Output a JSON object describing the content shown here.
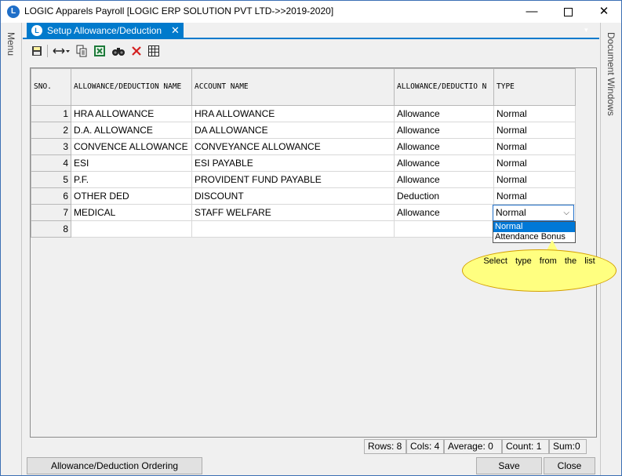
{
  "window": {
    "title": "LOGIC Apparels Payroll  [LOGIC ERP SOLUTION PVT LTD->>2019-2020]",
    "logo_letter": "L",
    "controls": {
      "minimize": "—",
      "close": "✕"
    }
  },
  "side": {
    "left_label": "Menu",
    "right_label": "Document Windows"
  },
  "tab": {
    "label": "Setup Allowance/Deduction",
    "close": "✕",
    "logo_letter": "L",
    "dropdown": "▾"
  },
  "toolbar": {
    "icons": [
      "save-icon",
      "column-resize-icon",
      "copy-icon",
      "excel-icon",
      "find-icon",
      "delete-icon",
      "grid-icon"
    ]
  },
  "grid": {
    "headers": {
      "sno": "SNO.",
      "name": "ALLOWANCE/DEDUCTION NAME",
      "account": "ACCOUNT NAME",
      "allowance_deduction": "ALLOWANCE/DEDUCTIO N",
      "type": "TYPE"
    },
    "rows": [
      {
        "sno": "1",
        "name": "HRA ALLOWANCE",
        "account": "HRA ALLOWANCE",
        "ad": "Allowance",
        "type": "Normal"
      },
      {
        "sno": "2",
        "name": "D.A. ALLOWANCE",
        "account": "DA ALLOWANCE",
        "ad": "Allowance",
        "type": "Normal"
      },
      {
        "sno": "3",
        "name": "CONVENCE ALLOWANCE",
        "account": "CONVEYANCE ALLOWANCE",
        "ad": "Allowance",
        "type": "Normal"
      },
      {
        "sno": "4",
        "name": "ESI",
        "account": "ESI PAYABLE",
        "ad": "Allowance",
        "type": "Normal"
      },
      {
        "sno": "5",
        "name": "P.F.",
        "account": "PROVIDENT FUND PAYABLE",
        "ad": "Allowance",
        "type": "Normal"
      },
      {
        "sno": "6",
        "name": "OTHER DED",
        "account": "DISCOUNT",
        "ad": "Deduction",
        "type": "Normal"
      },
      {
        "sno": "7",
        "name": "MEDICAL",
        "account": "STAFF WELFARE",
        "ad": "Allowance",
        "type": ""
      },
      {
        "sno": "8",
        "name": "",
        "account": "",
        "ad": "",
        "type": ""
      }
    ]
  },
  "type_editor": {
    "value": "Normal",
    "options": [
      "Normal",
      "Attendance Bonus"
    ],
    "selected": "Normal"
  },
  "tooltip": {
    "text": "Select type from the list"
  },
  "status": {
    "rows": "Rows: 8",
    "cols": "Cols: 4",
    "average": "Average: 0",
    "count": "Count: 1",
    "sum": "Sum:0"
  },
  "buttons": {
    "ordering": "Allowance/Deduction Ordering",
    "save": "Save",
    "close": "Close"
  }
}
